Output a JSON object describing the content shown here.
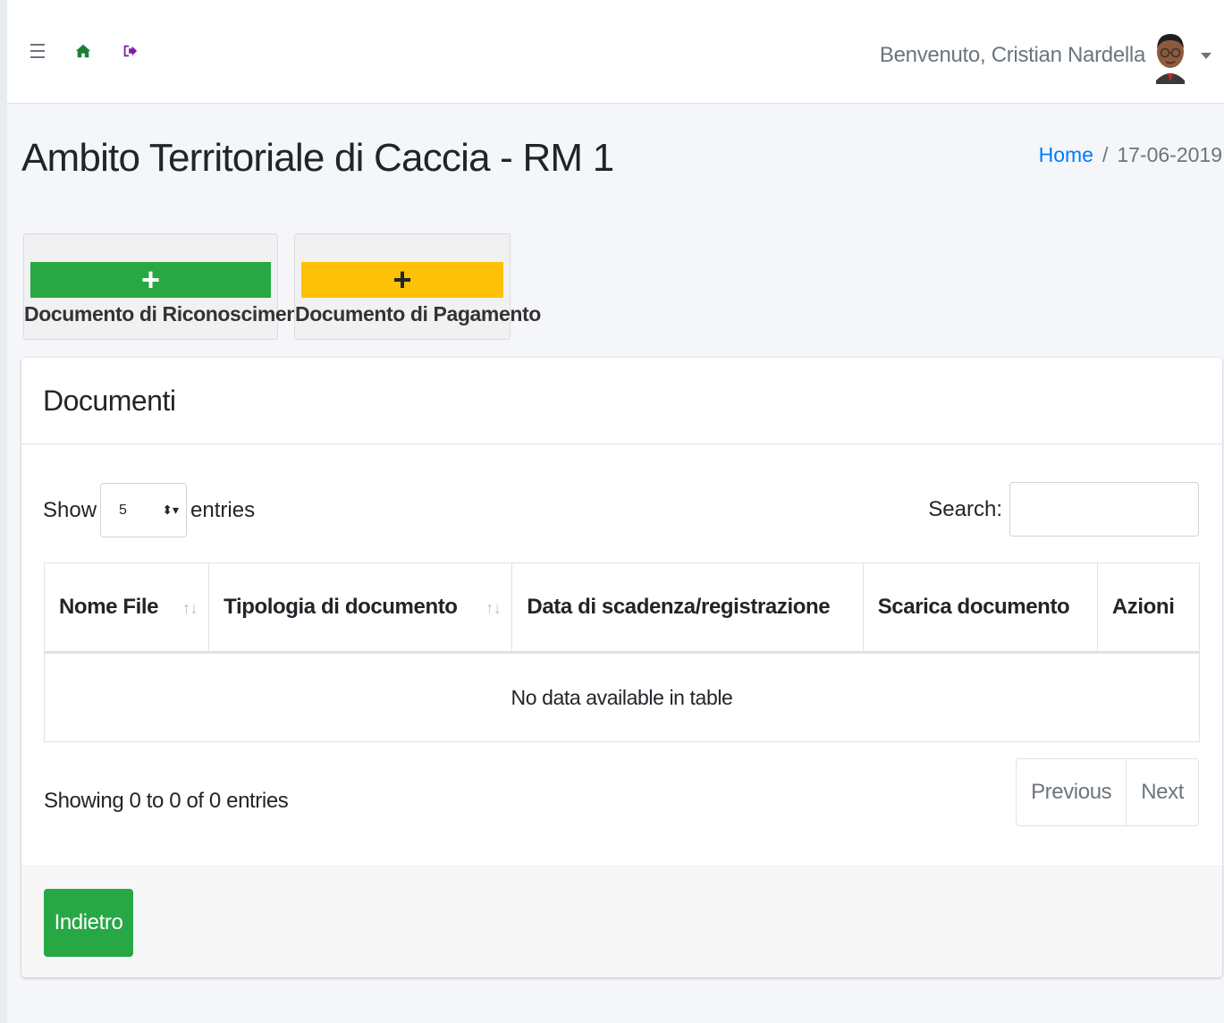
{
  "navbar": {
    "welcome": "Benvenuto, Cristian Nardella"
  },
  "page": {
    "title": "Ambito Territoriale di Caccia - RM 1"
  },
  "breadcrumb": {
    "home": "Home",
    "separator": "/",
    "date": "17-06-2019"
  },
  "actions": {
    "add_id_doc": {
      "icon": "+",
      "label": "Documento di Riconoscimento",
      "color": "#28a745"
    },
    "add_payment_doc": {
      "icon": "+",
      "label": "Documento di Pagamento",
      "color": "#ffc107"
    }
  },
  "card": {
    "title": "Documenti"
  },
  "table_controls": {
    "show_label": "Show",
    "entries_value": "5",
    "entries_label": "entries",
    "search_label": "Search:",
    "search_value": ""
  },
  "table": {
    "columns": [
      "Nome File",
      "Tipologia di documento",
      "Data di scadenza/registrazione",
      "Scarica documento",
      "Azioni"
    ],
    "empty_message": "No data available in table",
    "sort_icon": "↑↓"
  },
  "footer_info": {
    "info": "Showing 0 to 0 of 0 entries",
    "previous": "Previous",
    "next": "Next"
  },
  "back_button": {
    "label": "Indietro",
    "color": "#28a745"
  }
}
